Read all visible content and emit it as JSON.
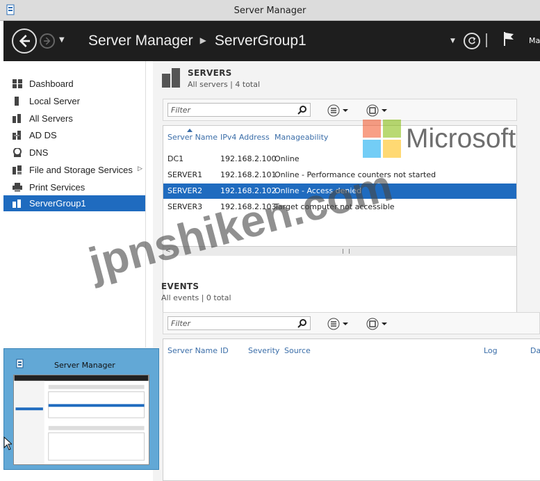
{
  "window": {
    "title": "Server Manager"
  },
  "header": {
    "breadcrumb_root": "Server Manager",
    "breadcrumb_current": "ServerGroup1",
    "manage_label": "Ma"
  },
  "sidebar": {
    "items": [
      {
        "label": "Dashboard",
        "icon": "dashboard-icon"
      },
      {
        "label": "Local Server",
        "icon": "server-icon"
      },
      {
        "label": "All Servers",
        "icon": "servers-icon"
      },
      {
        "label": "AD DS",
        "icon": "ad-ds-icon"
      },
      {
        "label": "DNS",
        "icon": "dns-icon"
      },
      {
        "label": "File and Storage Services",
        "icon": "file-storage-icon",
        "has_submenu": true
      },
      {
        "label": "Print Services",
        "icon": "printer-icon"
      },
      {
        "label": "ServerGroup1",
        "icon": "server-group-icon",
        "selected": true
      }
    ]
  },
  "servers": {
    "title": "SERVERS",
    "subtitle": "All servers | 4 total",
    "filter_placeholder": "Filter",
    "columns": [
      "Server Name",
      "IPv4 Address",
      "Manageability"
    ],
    "rows": [
      {
        "name": "DC1",
        "ip": "192.168.2.100",
        "manageability": "Online"
      },
      {
        "name": "SERVER1",
        "ip": "192.168.2.101",
        "manageability": "Online - Performance counters not started"
      },
      {
        "name": "SERVER2",
        "ip": "192.168.2.102",
        "manageability": "Online - Access denied",
        "selected": true
      },
      {
        "name": "SERVER3",
        "ip": "192.168.2.103",
        "manageability": "Target computer not accessible"
      }
    ],
    "scroll_left_glyph": "<",
    "scroll_grip_glyph": "III"
  },
  "events": {
    "title": "EVENTS",
    "subtitle": "All events | 0 total",
    "filter_placeholder": "Filter",
    "columns": [
      "Server Name",
      "ID",
      "Severity",
      "Source",
      "Log",
      "Da"
    ]
  },
  "taskbar_preview": {
    "title": "Server Manager"
  },
  "overlay": {
    "logo_text": "Microsoft",
    "watermark": "jpnshiken.com"
  },
  "colors": {
    "selection": "#1f6bbf",
    "header_bg": "#1e1e1e",
    "column_header": "#3a6da8",
    "preview_bg": "#62a8d6"
  }
}
